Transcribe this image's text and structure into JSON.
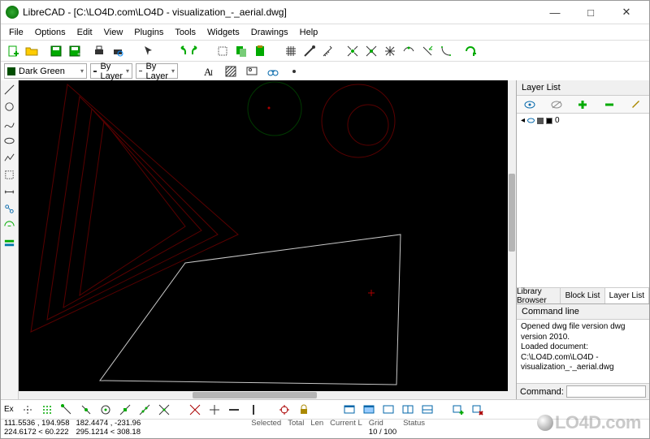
{
  "title": "LibreCAD - [C:\\LO4D.com\\LO4D - visualization_-_aerial.dwg]",
  "menu": {
    "file": "File",
    "options": "Options",
    "edit": "Edit",
    "view": "View",
    "plugins": "Plugins",
    "tools": "Tools",
    "widgets": "Widgets",
    "drawings": "Drawings",
    "help": "Help"
  },
  "winbtn": {
    "min": "—",
    "max": "□",
    "close": "✕"
  },
  "prop": {
    "color": "Dark Green",
    "width": "By Layer",
    "ltype": "By Layer"
  },
  "right": {
    "layer_title": "Layer List",
    "layer0": "0",
    "tab_lib": "Library Browser",
    "tab_block": "Block List",
    "tab_layer": "Layer List",
    "cmd_title": "Command line",
    "cmd_out": "Opened dwg file version dwg version 2010.\nLoaded document: C:\\LO4D.com\\LO4D - visualization_-_aerial.dwg",
    "cmd_label": "Command:"
  },
  "snap": {
    "ex": "Ex"
  },
  "status": {
    "c1a": "111.5536 , 194.958",
    "c1b": "224.6172 < 60.222",
    "c2a": "182.4474 , -231.96",
    "c2b": "295.1214 < 308.18",
    "sel": "Selected",
    "tot": "Total",
    "len": "Len",
    "cur": "Current L",
    "grid": "Grid",
    "gridv": "10 / 100",
    "st": "Status"
  },
  "watermark": "LO4D.com"
}
